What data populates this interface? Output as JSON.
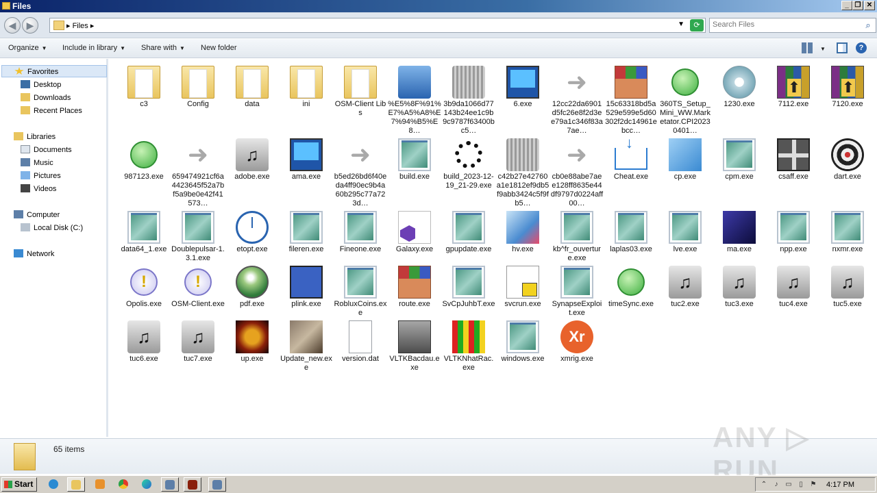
{
  "window": {
    "title": "Files"
  },
  "address": {
    "crumb": "Files",
    "search_placeholder": "Search Files"
  },
  "toolbar": {
    "organize": "Organize",
    "include_in_library": "Include in library",
    "share_with": "Share with",
    "new_folder": "New folder"
  },
  "nav": {
    "favorites": "Favorites",
    "desktop": "Desktop",
    "downloads": "Downloads",
    "recent_places": "Recent Places",
    "libraries": "Libraries",
    "documents": "Documents",
    "music": "Music",
    "pictures": "Pictures",
    "videos": "Videos",
    "computer": "Computer",
    "local_disk": "Local Disk (C:)",
    "network": "Network"
  },
  "items": [
    {
      "label": "c3",
      "icon": "folder-icon"
    },
    {
      "label": "Config",
      "icon": "folder-icon"
    },
    {
      "label": "data",
      "icon": "folder-icon"
    },
    {
      "label": "ini",
      "icon": "folder-icon"
    },
    {
      "label": "OSM-Client Libs",
      "icon": "folder-icon"
    },
    {
      "label": "%E5%8F%91%E7%A5%A8%E7%94%B5%E8…",
      "icon": "shield-folder-icon"
    },
    {
      "label": "3b9da1066d77143b24ee1c9b9c9787f63400bc5…",
      "icon": "blurred-file-icon"
    },
    {
      "label": "6.exe",
      "icon": "monitor-icon"
    },
    {
      "label": "12cc22da6901d5fc26e8f2d3ee79a1c346f83a7ae…",
      "icon": "shortcut-arrow-icon"
    },
    {
      "label": "15c63318bd5a529e599e5d60302f2dc14961ebcc…",
      "icon": "winrar-box-icon"
    },
    {
      "label": "360TS_Setup_Mini_WW.Marketator.CPI20230401…",
      "icon": "installer-icon"
    },
    {
      "label": "1230.exe",
      "icon": "cd-icon"
    },
    {
      "label": "7112.exe",
      "icon": "winrar-icon"
    },
    {
      "label": "7120.exe",
      "icon": "winrar-icon"
    },
    {
      "label": "987123.exe",
      "icon": "green-orb-icon"
    },
    {
      "label": "659474921cf6a4423645f52a7bf5a9be0e42f41573…",
      "icon": "shortcut-arrow-icon"
    },
    {
      "label": "adobe.exe",
      "icon": "music-icon"
    },
    {
      "label": "ama.exe",
      "icon": "network-computer-icon"
    },
    {
      "label": "b5ed26bd6f40eda4ff90ec9b4a60b295c77a723d…",
      "icon": "shortcut-arrow-icon"
    },
    {
      "label": "build.exe",
      "icon": "app-window-icon"
    },
    {
      "label": "build_2023-12-19_21-29.exe",
      "icon": "spinner-icon"
    },
    {
      "label": "c42b27e42760a1e1812ef9db5f9abb3424c5f9fb5…",
      "icon": "blurred-file-icon"
    },
    {
      "label": "cb0e88abe7aee128ff8635e44df9797d0224aff00…",
      "icon": "shortcut-arrow-icon"
    },
    {
      "label": "Cheat.exe",
      "icon": "download-tray-icon"
    },
    {
      "label": "cp.exe",
      "icon": "cube-icon"
    },
    {
      "label": "cpm.exe",
      "icon": "app-window-icon"
    },
    {
      "label": "csaff.exe",
      "icon": "gift-icon"
    },
    {
      "label": "dart.exe",
      "icon": "dartboard-icon"
    },
    {
      "label": "data64_1.exe",
      "icon": "app-window-icon"
    },
    {
      "label": "Doublepulsar-1.3.1.exe",
      "icon": "app-window-icon"
    },
    {
      "label": "etopt.exe",
      "icon": "clock-icon"
    },
    {
      "label": "fileren.exe",
      "icon": "app-window-icon"
    },
    {
      "label": "Fineone.exe",
      "icon": "app-window-icon"
    },
    {
      "label": "Galaxy.exe",
      "icon": "visual-studio-icon"
    },
    {
      "label": "gpupdate.exe",
      "icon": "app-window-icon"
    },
    {
      "label": "hv.exe",
      "icon": "hv-icon"
    },
    {
      "label": "kb^fr_ouverture.exe",
      "icon": "app-window-icon"
    },
    {
      "label": "laplas03.exe",
      "icon": "app-window-icon"
    },
    {
      "label": "lve.exe",
      "icon": "app-window-icon"
    },
    {
      "label": "ma.exe",
      "icon": "ma-icon"
    },
    {
      "label": "npp.exe",
      "icon": "app-window-icon"
    },
    {
      "label": "nxmr.exe",
      "icon": "app-window-icon"
    },
    {
      "label": "Opolis.exe",
      "icon": "warning-orb-icon"
    },
    {
      "label": "OSM-Client.exe",
      "icon": "warning-orb-icon"
    },
    {
      "label": "pdf.exe",
      "icon": "globe-icon"
    },
    {
      "label": "plink.exe",
      "icon": "plink-icon"
    },
    {
      "label": "RobluxCoins.exe",
      "icon": "app-window-icon"
    },
    {
      "label": "route.exe",
      "icon": "winrar-box-icon"
    },
    {
      "label": "SvCpJuhbT.exe",
      "icon": "app-window-icon"
    },
    {
      "label": "svcrun.exe",
      "icon": "house-document-icon"
    },
    {
      "label": "SynapseExploit.exe",
      "icon": "app-window-icon"
    },
    {
      "label": "timeSync.exe",
      "icon": "green-orb-icon"
    },
    {
      "label": "tuc2.exe",
      "icon": "music-icon"
    },
    {
      "label": "tuc3.exe",
      "icon": "music-icon"
    },
    {
      "label": "tuc4.exe",
      "icon": "music-icon"
    },
    {
      "label": "tuc5.exe",
      "icon": "music-icon"
    },
    {
      "label": "tuc6.exe",
      "icon": "music-icon"
    },
    {
      "label": "tuc7.exe",
      "icon": "music-icon"
    },
    {
      "label": "up.exe",
      "icon": "up-logo-icon"
    },
    {
      "label": "Update_new.exe",
      "icon": "update-box-icon"
    },
    {
      "label": "version.dat",
      "icon": "blank-document-icon"
    },
    {
      "label": "VLTKBacdau.exe",
      "icon": "warrior-icon"
    },
    {
      "label": "VLTKNhatRac.exe",
      "icon": "colorful-logo-icon"
    },
    {
      "label": "windows.exe",
      "icon": "app-window-icon"
    },
    {
      "label": "xmrig.exe",
      "icon": "xmrig-icon"
    }
  ],
  "icon_glyphs": {
    "xmrig": "Xr"
  },
  "status": {
    "count": "65 items"
  },
  "watermark": "ANY ▷ RUN",
  "taskbar": {
    "start": "Start",
    "clock": "4:17 PM"
  },
  "colors": {
    "selection": "#dbe8f7",
    "titlebar": "#0b246a",
    "accent": "#2a64b0"
  }
}
